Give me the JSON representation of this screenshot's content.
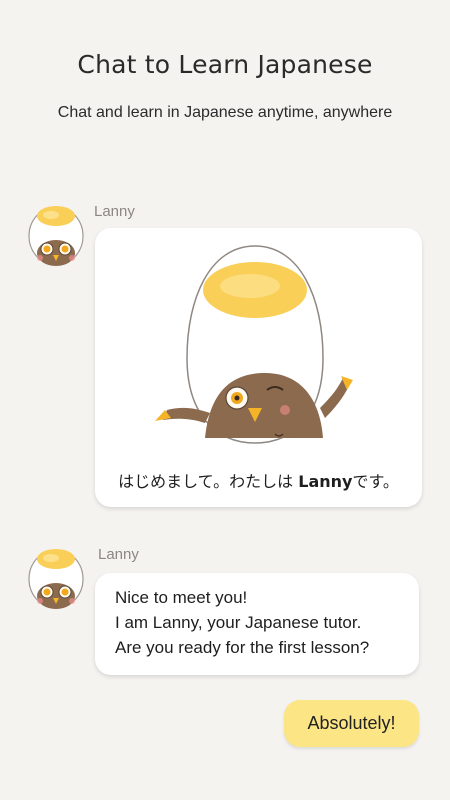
{
  "header": {
    "title": "Chat to Learn Japanese",
    "subtitle": "Chat and learn in Japanese anytime, anywhere"
  },
  "messages": [
    {
      "sender": "Lanny",
      "avatar_icon": "egg-bird-avatar-icon",
      "illustration_icon": "egg-bird-waving-illustration",
      "caption_pre": "はじめまして。わたしは ",
      "caption_bold": "Lanny",
      "caption_post": "です。"
    },
    {
      "sender": "Lanny",
      "avatar_icon": "egg-bird-avatar-icon",
      "lines": [
        "Nice to meet you!",
        "I am Lanny, your Japanese tutor.",
        "Are you ready for the first lesson?"
      ]
    }
  ],
  "reply": {
    "label": "Absolutely!"
  },
  "colors": {
    "background": "#f5f3f0",
    "bubble": "#ffffff",
    "reply_bubble": "#fce585",
    "yolk": "#f9cf58"
  }
}
